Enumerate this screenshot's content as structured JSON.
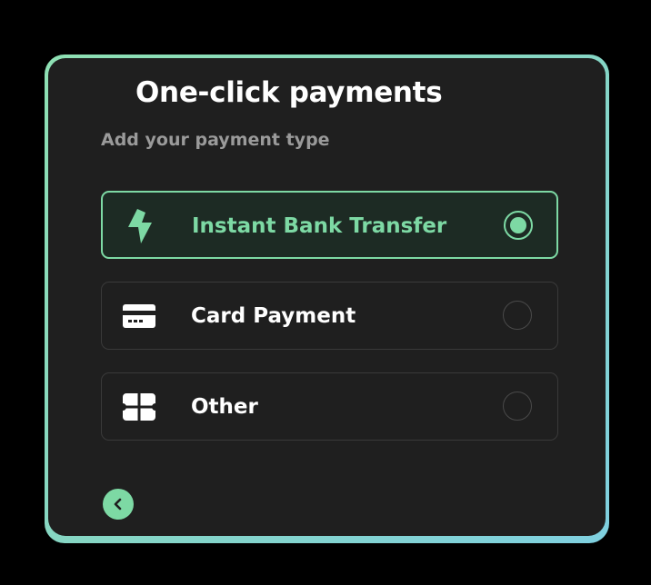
{
  "header": {
    "title": "One-click payments",
    "subtitle": "Add your payment type"
  },
  "options": [
    {
      "label": "Instant Bank Transfer",
      "icon": "lightning-bolt-icon",
      "selected": true
    },
    {
      "label": "Card Payment",
      "icon": "credit-card-icon",
      "selected": false
    },
    {
      "label": "Other",
      "icon": "ticket-icon",
      "selected": false
    }
  ],
  "navigation": {
    "back_icon": "chevron-left-icon"
  },
  "colors": {
    "accent": "#7dd9a4",
    "card_background": "#1f1f1f",
    "page_background": "#000000",
    "border_unselected": "#3a3a3a",
    "subtitle_text": "#9a9a9a"
  }
}
